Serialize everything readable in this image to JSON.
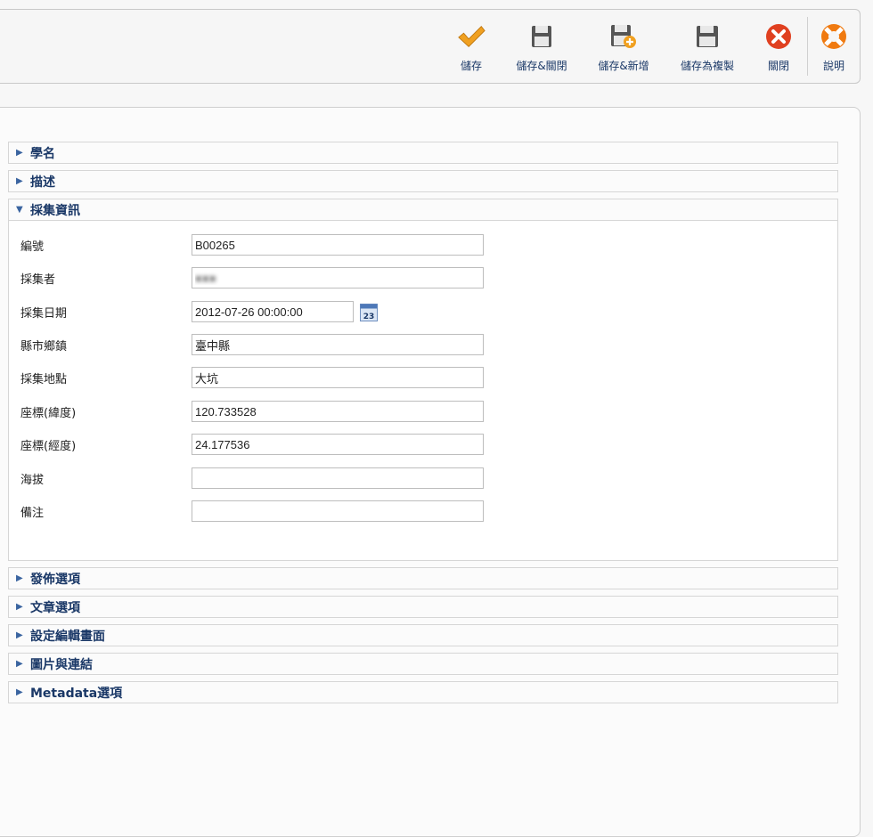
{
  "toolbar": {
    "buttons": [
      {
        "id": "save",
        "label": "儲存",
        "icon": "checkmark-icon"
      },
      {
        "id": "save-close",
        "label": "儲存&關閉",
        "icon": "floppy-icon"
      },
      {
        "id": "save-new",
        "label": "儲存&新增",
        "icon": "floppy-plus-icon"
      },
      {
        "id": "save-copy",
        "label": "儲存為複製",
        "icon": "floppy-copy-icon"
      },
      {
        "id": "close",
        "label": "關閉",
        "icon": "close-icon"
      },
      {
        "id": "help",
        "label": "說明",
        "icon": "lifebuoy-icon"
      }
    ],
    "colors": {
      "save": "#f0a020",
      "close": "#e04020",
      "help": "#f07a10"
    }
  },
  "sections": {
    "scientific_name": {
      "title": "學名",
      "expanded": false
    },
    "description": {
      "title": "描述",
      "expanded": false
    },
    "collection_info": {
      "title": "採集資訊",
      "expanded": true,
      "fields": {
        "number": {
          "label": "編號",
          "value": "B00265"
        },
        "collector": {
          "label": "採集者",
          "value": "■■■"
        },
        "date": {
          "label": "採集日期",
          "value": "2012-07-26 00:00:00"
        },
        "county": {
          "label": "縣市鄉鎮",
          "value": "臺中縣"
        },
        "location": {
          "label": "採集地點",
          "value": "大坑"
        },
        "latitude": {
          "label": "座標(緯度)",
          "value": "120.733528"
        },
        "longitude": {
          "label": "座標(經度)",
          "value": "24.177536"
        },
        "altitude": {
          "label": "海拔",
          "value": ""
        },
        "note": {
          "label": "備注",
          "value": ""
        }
      },
      "calendar_icon_text": "23"
    },
    "publishing": {
      "title": "發佈選項",
      "expanded": false
    },
    "article": {
      "title": "文章選項",
      "expanded": false
    },
    "editor": {
      "title": "設定編輯畫面",
      "expanded": false
    },
    "images": {
      "title": "圖片與連結",
      "expanded": false
    },
    "metadata": {
      "title": "Metadata選項",
      "expanded": false
    }
  },
  "arrows": {
    "collapsed": "▶",
    "expanded": "▼"
  }
}
